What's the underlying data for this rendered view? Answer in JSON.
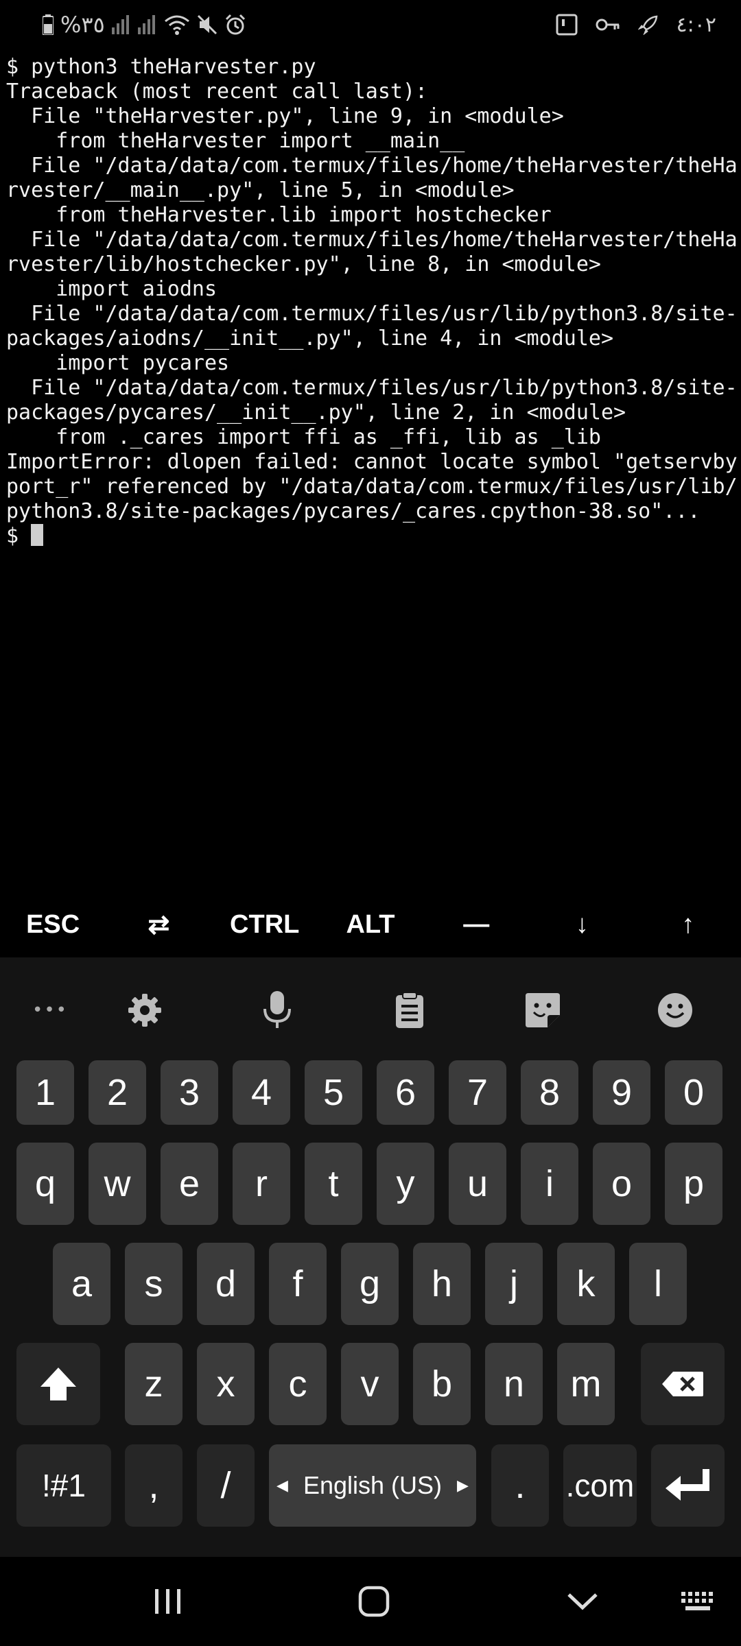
{
  "status_bar": {
    "battery_percent": "%٣٥",
    "time": "٤:٠٢",
    "icons": [
      "battery-icon",
      "signal-icon",
      "signal-icon",
      "wifi-icon",
      "mute-icon",
      "alarm-icon",
      "screenshot-icon",
      "key-icon",
      "rocket-icon"
    ]
  },
  "terminal": {
    "lines": [
      "$ python3 theHarvester.py",
      "Traceback (most recent call last):",
      "  File \"theHarvester.py\", line 9, in <module>",
      "    from theHarvester import __main__",
      "  File \"/data/data/com.termux/files/home/theHarvester/theHa",
      "rvester/__main__.py\", line 5, in <module>",
      "    from theHarvester.lib import hostchecker",
      "  File \"/data/data/com.termux/files/home/theHarvester/theHa",
      "rvester/lib/hostchecker.py\", line 8, in <module>",
      "    import aiodns",
      "  File \"/data/data/com.termux/files/usr/lib/python3.8/site-",
      "packages/aiodns/__init__.py\", line 4, in <module>",
      "    import pycares",
      "  File \"/data/data/com.termux/files/usr/lib/python3.8/site-",
      "packages/pycares/__init__.py\", line 2, in <module>",
      "    from ._cares import ffi as _ffi, lib as _lib",
      "ImportError: dlopen failed: cannot locate symbol \"getservby",
      "port_r\" referenced by \"/data/data/com.termux/files/usr/lib/",
      "python3.8/site-packages/pycares/_cares.cpython-38.so\"...",
      "$ "
    ]
  },
  "extra_keys": [
    {
      "name": "esc-key",
      "label": "ESC"
    },
    {
      "name": "tab-key",
      "label": "⇄"
    },
    {
      "name": "ctrl-key",
      "label": "CTRL"
    },
    {
      "name": "alt-key",
      "label": "ALT"
    },
    {
      "name": "dash-key",
      "label": "—"
    },
    {
      "name": "arrow-down-key",
      "label": "↓"
    },
    {
      "name": "arrow-up-key",
      "label": "↑"
    }
  ],
  "keyboard": {
    "toolbar": [
      "more-icon",
      "settings-icon",
      "microphone-icon",
      "clipboard-icon",
      "sticker-icon",
      "emoji-icon"
    ],
    "more_label": "•••",
    "number_row": [
      "1",
      "2",
      "3",
      "4",
      "5",
      "6",
      "7",
      "8",
      "9",
      "0"
    ],
    "row1": [
      "q",
      "w",
      "e",
      "r",
      "t",
      "y",
      "u",
      "i",
      "o",
      "p"
    ],
    "row2": [
      "a",
      "s",
      "d",
      "f",
      "g",
      "h",
      "j",
      "k",
      "l"
    ],
    "row3": [
      "z",
      "x",
      "c",
      "v",
      "b",
      "n",
      "m"
    ],
    "symbols_label": "!#1",
    "comma_label": ",",
    "slash_label": "/",
    "language_label": "English (US)",
    "period_label": ".",
    "dotcom_label": ".com"
  },
  "nav_bar": {
    "icons": [
      "recent-apps-icon",
      "home-icon",
      "back-icon",
      "keyboard-switch-icon"
    ]
  }
}
